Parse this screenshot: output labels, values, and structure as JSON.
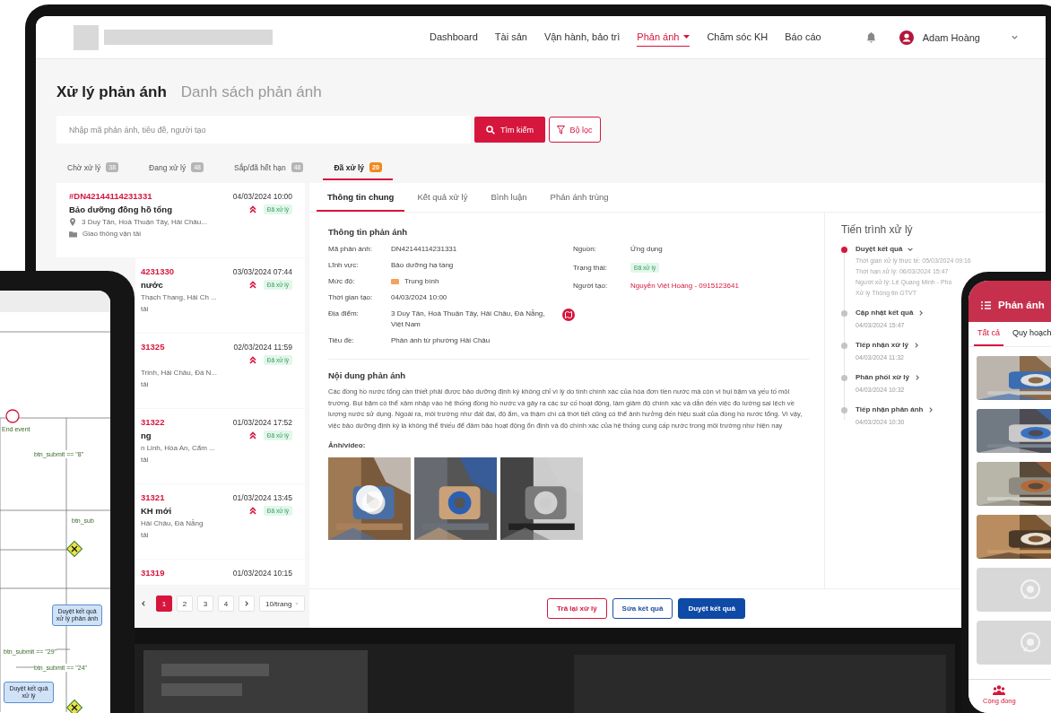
{
  "nav": {
    "items": [
      {
        "label": "Dashboard",
        "selected": false,
        "dropdown": false
      },
      {
        "label": "Tài sản",
        "selected": false,
        "dropdown": false
      },
      {
        "label": "Vận hành, bảo trì",
        "selected": false,
        "dropdown": false
      },
      {
        "label": "Phản ánh",
        "selected": true,
        "dropdown": true
      },
      {
        "label": "Chăm sóc KH",
        "selected": false,
        "dropdown": false
      },
      {
        "label": "Báo cáo",
        "selected": false,
        "dropdown": false
      }
    ],
    "user": {
      "name": "Adam Hoàng"
    }
  },
  "page": {
    "title": "Xử lý phản ánh",
    "subtitle": "Danh sách phản ánh"
  },
  "search": {
    "placeholder": "Nhập mã phản ánh, tiêu đề, người tạo",
    "button": "Tìm kiếm",
    "filter": "Bộ lọc"
  },
  "status_tabs": [
    {
      "label": "Chờ xử lý",
      "count": "38",
      "selected": false
    },
    {
      "label": "Đang xử lý",
      "count": "48",
      "selected": false
    },
    {
      "label": "Sắp/đã hết hạn",
      "count": "48",
      "selected": false
    },
    {
      "label": "Đã xử lý",
      "count": "20",
      "selected": true
    }
  ],
  "list": [
    {
      "id": "#DN42144114231331",
      "date": "04/03/2024 10:00",
      "title": "Bảo dưỡng đồng hồ tổng",
      "location": "3 Duy Tân, Hoà Thuận Tây, Hải Châu...",
      "category": "Giao thông vận tải",
      "status": "Đã xử lý"
    },
    {
      "id": "4231330",
      "date": "03/03/2024 07:44",
      "title": "nước",
      "location": "Thạch Thang, Hải Ch ...",
      "category": "tải",
      "status": "Đã xử lý"
    },
    {
      "id": "31325",
      "date": "02/03/2024 11:59",
      "location": "Trinh, Hải Châu, Đà N...",
      "category": "tải",
      "status": "Đã xử lý"
    },
    {
      "id": "31322",
      "date": "01/03/2024 17:52",
      "title": "ng",
      "location": "n Linh, Hòa An, Cẩm ...",
      "category": "tải",
      "status": "Đã xử lý"
    },
    {
      "id": "31321",
      "date": "01/03/2024 13:45",
      "title": "KH mới",
      "location": "Hải Châu, Đà Nẵng",
      "category": "tải",
      "status": "Đã xử lý"
    },
    {
      "id": "31319",
      "date": "01/03/2024 10:15"
    }
  ],
  "pagination": {
    "pages": [
      {
        "label": "1",
        "selected": true
      },
      {
        "label": "2",
        "selected": false
      },
      {
        "label": "3",
        "selected": false
      },
      {
        "label": "4",
        "selected": false
      }
    ],
    "page_size": "10/trang"
  },
  "detail": {
    "tabs": [
      {
        "label": "Thông tin chung",
        "selected": true
      },
      {
        "label": "Kết quả xử lý",
        "selected": false
      },
      {
        "label": "Bình luận",
        "selected": false
      },
      {
        "label": "Phản ánh trùng",
        "selected": false
      }
    ],
    "info_title": "Thông tin phản ánh",
    "fields_left": [
      {
        "label": "Mã phản ánh:",
        "value": "DN42144114231331",
        "kind": "text"
      },
      {
        "label": "Lĩnh vực:",
        "value": "Bảo dưỡng hạ tầng",
        "kind": "text"
      },
      {
        "label": "Mức độ:",
        "value": "Trung bình",
        "kind": "level"
      },
      {
        "label": "Thời gian tạo:",
        "value": "04/03/2024 10:00",
        "kind": "text"
      },
      {
        "label": "Địa điểm:",
        "value": "3 Duy Tân, Hoà Thuận Tây, Hải Châu, Đà Nẵng, Việt Nam",
        "kind": "map"
      },
      {
        "label": "Tiêu đề:",
        "value": "Phản ánh từ phường Hải Châu",
        "kind": "text"
      }
    ],
    "fields_right": [
      {
        "label": "Nguồn:",
        "value": "Ứng dụng",
        "kind": "text"
      },
      {
        "label": "Trạng thái:",
        "value": "Đã xử lý",
        "kind": "badge"
      },
      {
        "label": "Người tạo:",
        "value": "Nguyễn Việt Hoàng - 0915123641",
        "kind": "link"
      }
    ],
    "content_title": "Nội dung phản ánh",
    "content": "Các đồng hồ nước tổng cần thiết phải được bảo dưỡng định kỳ không chỉ vì lý do tính chính xác của hóa đơn tiền nước mà còn vì bụi bặm và yếu tố môi trường. Bụi bặm có thể xâm nhập vào hệ thống đồng hồ nước và gây ra các sự cố hoạt động, làm giảm độ chính xác và dẫn đến việc đo lường sai lệch về lượng nước sử dụng. Ngoài ra, môi trường như đất đai, độ ẩm, và thậm chí cả thời tiết cũng có thể ảnh hưởng đến hiệu suất của đồng hồ nước tổng. Vì vậy, việc bảo dưỡng định kỳ là không thể thiếu để đảm bảo hoạt động ổn định và độ chính xác của hệ thống cung cấp nước trong môi trường như hiện nay",
    "media_label": "Ảnh/video:",
    "media": [
      {
        "kind": "video"
      },
      {
        "kind": "picture"
      },
      {
        "kind": "picture"
      }
    ],
    "actions": [
      {
        "label": "Trả lại xử lý",
        "kind": "danger"
      },
      {
        "label": "Sửa kết quả",
        "kind": "outline"
      },
      {
        "label": "Duyệt kết quả",
        "kind": "primary"
      }
    ]
  },
  "timeline": {
    "title": "Tiến trình xử lý",
    "steps": [
      {
        "title": "Duyệt kết quả",
        "current": true,
        "expanded": true,
        "details": [
          "Thời gian xử lý thực tế: 05/03/2024 09:16",
          "Thời hạn xử lý: 06/03/2024 15:47",
          "Người xử lý: Lê Quang Minh - Phò",
          "Xử lý Thông tin GTVT"
        ]
      },
      {
        "title": "Cập nhật kết quả",
        "current": false,
        "expanded": false,
        "time": "04/03/2024 15:47"
      },
      {
        "title": "Tiếp nhận xử lý",
        "current": false,
        "expanded": false,
        "time": "04/03/2024 11:32"
      },
      {
        "title": "Phân phối xử lý",
        "current": false,
        "expanded": false,
        "time": "04/03/2024 10:32"
      },
      {
        "title": "Tiếp nhận phản ánh",
        "current": false,
        "expanded": false,
        "time": "04/03/2024 10:30"
      }
    ]
  },
  "tablet": {
    "labels": [
      {
        "text": "End event",
        "kind": "plain"
      },
      {
        "text": "btn_submit == \"8\"",
        "kind": "plain"
      },
      {
        "text": "btn_sub",
        "kind": "plain"
      },
      {
        "text": "Duyệt kết quả xử lý phản ánh",
        "kind": "task"
      },
      {
        "text": "btn_submit == \"29\"",
        "kind": "plain"
      },
      {
        "text": "btn_submit == \"24\"",
        "kind": "plain"
      },
      {
        "text": "Duyệt kết quả xử lý",
        "kind": "task"
      }
    ]
  },
  "phone": {
    "title": "Phản ánh",
    "tabs": [
      {
        "label": "Tất cả",
        "selected": true
      },
      {
        "label": "Quy hoạch",
        "selected": false
      }
    ],
    "cards": [
      {
        "kind": "picture"
      },
      {
        "kind": "picture"
      },
      {
        "kind": "picture"
      },
      {
        "kind": "picture"
      },
      {
        "kind": "placeholder"
      },
      {
        "kind": "placeholder"
      }
    ],
    "nav": [
      {
        "label": "Cộng đồng",
        "selected": true
      }
    ]
  }
}
